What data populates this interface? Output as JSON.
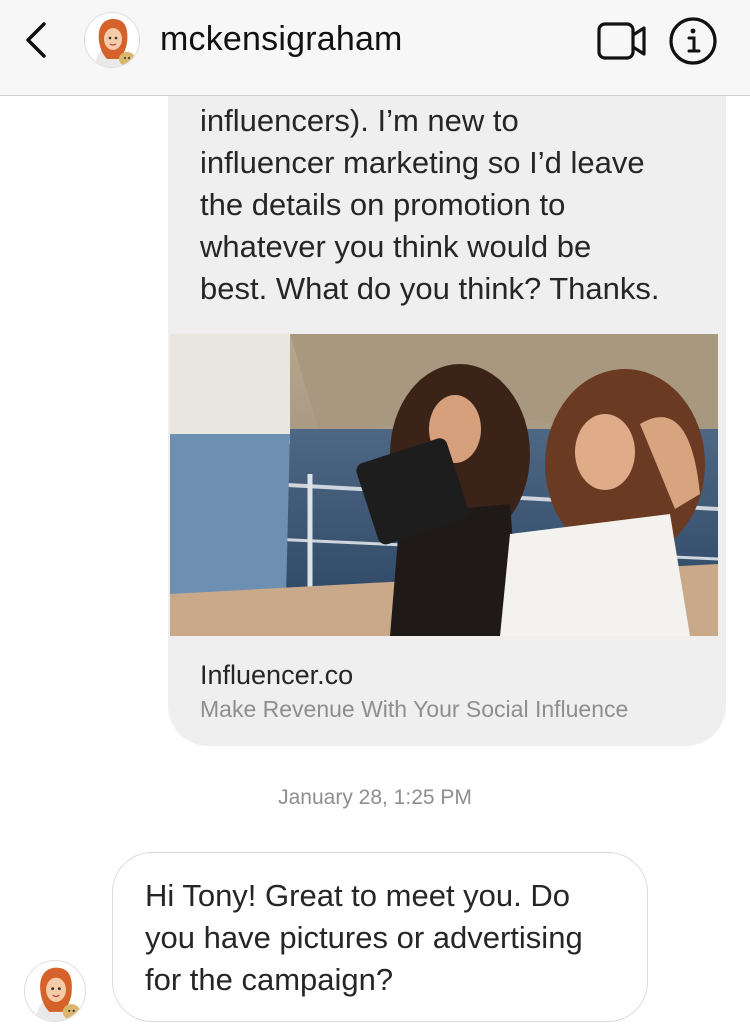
{
  "header": {
    "username": "mckensigraham",
    "back_icon": "chevron-left-icon",
    "video_icon": "video-camera-icon",
    "info_icon": "info-icon",
    "icons": [
      "chevron-left-icon",
      "avatar",
      "video-camera-icon",
      "info-icon"
    ]
  },
  "messages": {
    "outgoing": {
      "lines": [
        "influencers). I’m new to",
        "influencer marketing so I’d leave",
        "the details on promotion to",
        "whatever you think would be",
        "best. What do you think? Thanks."
      ],
      "link_preview": {
        "title": "Influencer.co",
        "subtitle": "Make Revenue With Your Social Influence"
      }
    },
    "timestamp": "January 28, 1:25 PM",
    "incoming": {
      "lines": [
        "Hi Tony! Great to meet you. Do",
        "you have pictures or advertising",
        "for the campaign?"
      ]
    }
  },
  "colors": {
    "header_bg": "#f7f7f7",
    "bubble_gray": "#efefef",
    "text": "#262626",
    "muted": "#8e8e8e"
  }
}
